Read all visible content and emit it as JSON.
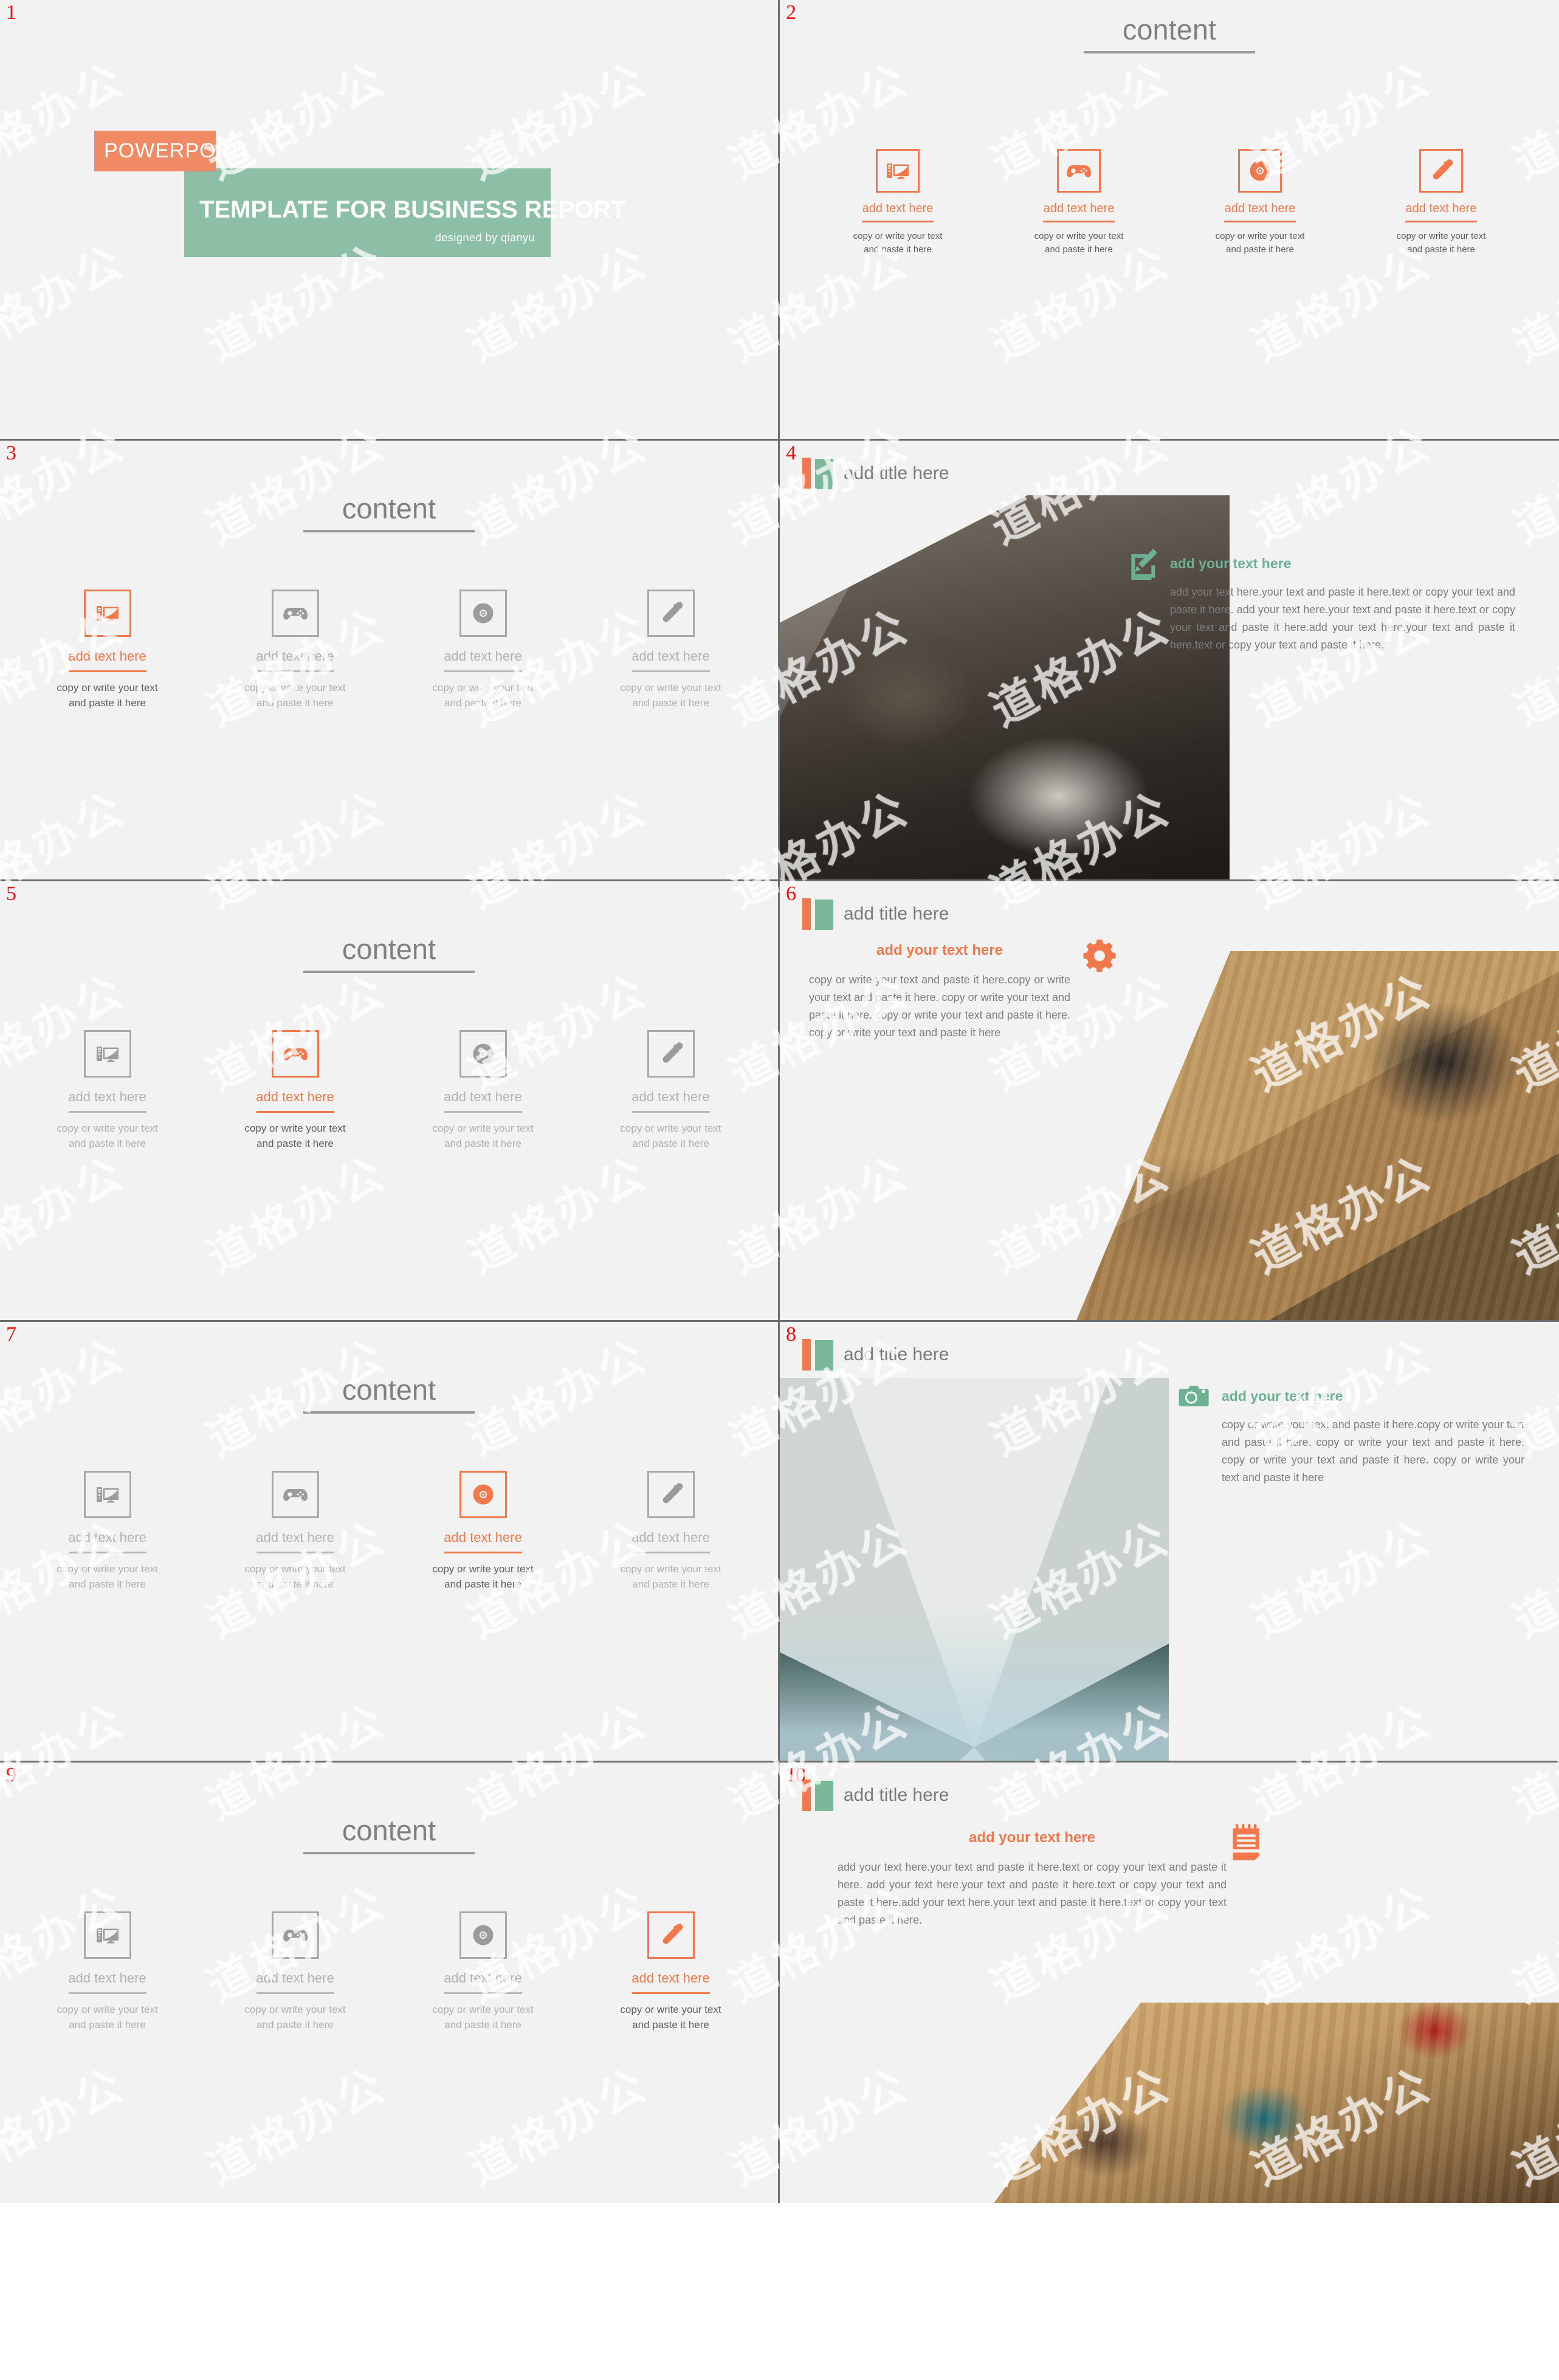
{
  "deck": {
    "slide_numbers": [
      "1",
      "2",
      "3",
      "4",
      "5",
      "6",
      "7",
      "8",
      "9",
      "10"
    ],
    "content_heading": "content",
    "title_here": "add title here",
    "text_here_heading": "add your text here",
    "icon_item_title": "add text here",
    "icon_item_body": "copy or write your text and paste it here"
  },
  "slide1": {
    "kicker": "POWERPOINT",
    "main_title": "TEMPLATE FOR BUSINESS REPORT",
    "designer": "designed by qianyu"
  },
  "slide2": {
    "heading": "content",
    "items": [
      {
        "icon": "computer-icon",
        "title": "add text here",
        "body": "copy or write your text and paste it here",
        "active": true
      },
      {
        "icon": "gamepad-icon",
        "title": "add text here",
        "body": "copy or write your text and paste it here",
        "active": true
      },
      {
        "icon": "disc-icon",
        "title": "add text here",
        "body": "copy or write your text and paste it here",
        "active": true
      },
      {
        "icon": "eyedropper-icon",
        "title": "add text here",
        "body": "copy or write your text and paste it here",
        "active": true
      }
    ]
  },
  "slide3": {
    "heading": "content",
    "active_index": 0,
    "items": [
      {
        "icon": "computer-icon",
        "title": "add text here",
        "body": "copy or write your text and paste it here"
      },
      {
        "icon": "gamepad-icon",
        "title": "add text here",
        "body": "copy or write your text and paste it here"
      },
      {
        "icon": "disc-icon",
        "title": "add text here",
        "body": "copy or write your text and paste it here"
      },
      {
        "icon": "eyedropper-icon",
        "title": "add text here",
        "body": "copy or write your text and paste it here"
      }
    ]
  },
  "slide4": {
    "title": "add title here",
    "icon": "edit-note-icon",
    "head": "add your text here",
    "body": "add your text here.your text and paste it here.text or copy your text and paste it here. add your text here.your text and paste it here.text or copy your text and paste it here.add your text here.your text and paste it here.text or copy your text and paste it here."
  },
  "slide5": {
    "heading": "content",
    "active_index": 1,
    "items": [
      {
        "icon": "computer-icon",
        "title": "add text here",
        "body": "copy or write your text and paste it here"
      },
      {
        "icon": "gamepad-icon",
        "title": "add text here",
        "body": "copy or write your text and paste it here"
      },
      {
        "icon": "disc-icon",
        "title": "add text here",
        "body": "copy or write your text and paste it here"
      },
      {
        "icon": "eyedropper-icon",
        "title": "add text here",
        "body": "copy or write your text and paste it here"
      }
    ]
  },
  "slide6": {
    "title": "add title here",
    "icon": "gear-icon",
    "head": "add your text here",
    "body": "copy or write your text and paste it here.copy or write your text and paste it here. copy or write your text and paste it here. copy or write your text and paste it here. copy or write your text and paste it here"
  },
  "slide7": {
    "heading": "content",
    "active_index": 2,
    "items": [
      {
        "icon": "computer-icon",
        "title": "add text here",
        "body": "copy or write your text and paste it here"
      },
      {
        "icon": "gamepad-icon",
        "title": "add text here",
        "body": "copy or write your text and paste it here"
      },
      {
        "icon": "disc-icon",
        "title": "add text here",
        "body": "copy or write your text and paste it here"
      },
      {
        "icon": "eyedropper-icon",
        "title": "add text here",
        "body": "copy or write your text and paste it here"
      }
    ]
  },
  "slide8": {
    "title": "add title here",
    "icon": "camera-icon",
    "head": "add your text here",
    "body": "copy or write your text and paste it here.copy or write your text and paste it here. copy or write your text and paste it here. copy or write your text and paste it here. copy or write your text and paste it here"
  },
  "slide9": {
    "heading": "content",
    "active_index": 3,
    "items": [
      {
        "icon": "computer-icon",
        "title": "add text here",
        "body": "copy or write your text and paste it here"
      },
      {
        "icon": "gamepad-icon",
        "title": "add text here",
        "body": "copy or write your text and paste it here"
      },
      {
        "icon": "disc-icon",
        "title": "add text here",
        "body": "copy or write your text and paste it here"
      },
      {
        "icon": "eyedropper-icon",
        "title": "add text here",
        "body": "copy or write your text and paste it here"
      }
    ]
  },
  "slide10": {
    "title": "add title here",
    "icon": "notepad-icon",
    "head": "add your text here",
    "body": "add your text here.your text and paste it here.text or copy your text and paste it here. add your text here.your text and paste it here.text or copy your text and paste it here.add your text here.your text and paste it here.text or copy your text and paste it here."
  },
  "colors": {
    "orange": "#f0784b",
    "orange_light": "#f08a65",
    "green": "#7bb89a",
    "green_title": "#8dbfa7",
    "gray_text": "#7d7d7d",
    "gray_icon": "#9b9b9b",
    "slide_bg": "#f2f2f2",
    "gutter": "#6d6d6d",
    "number": "#e8100f"
  },
  "watermark": {
    "text": "道格办公"
  }
}
